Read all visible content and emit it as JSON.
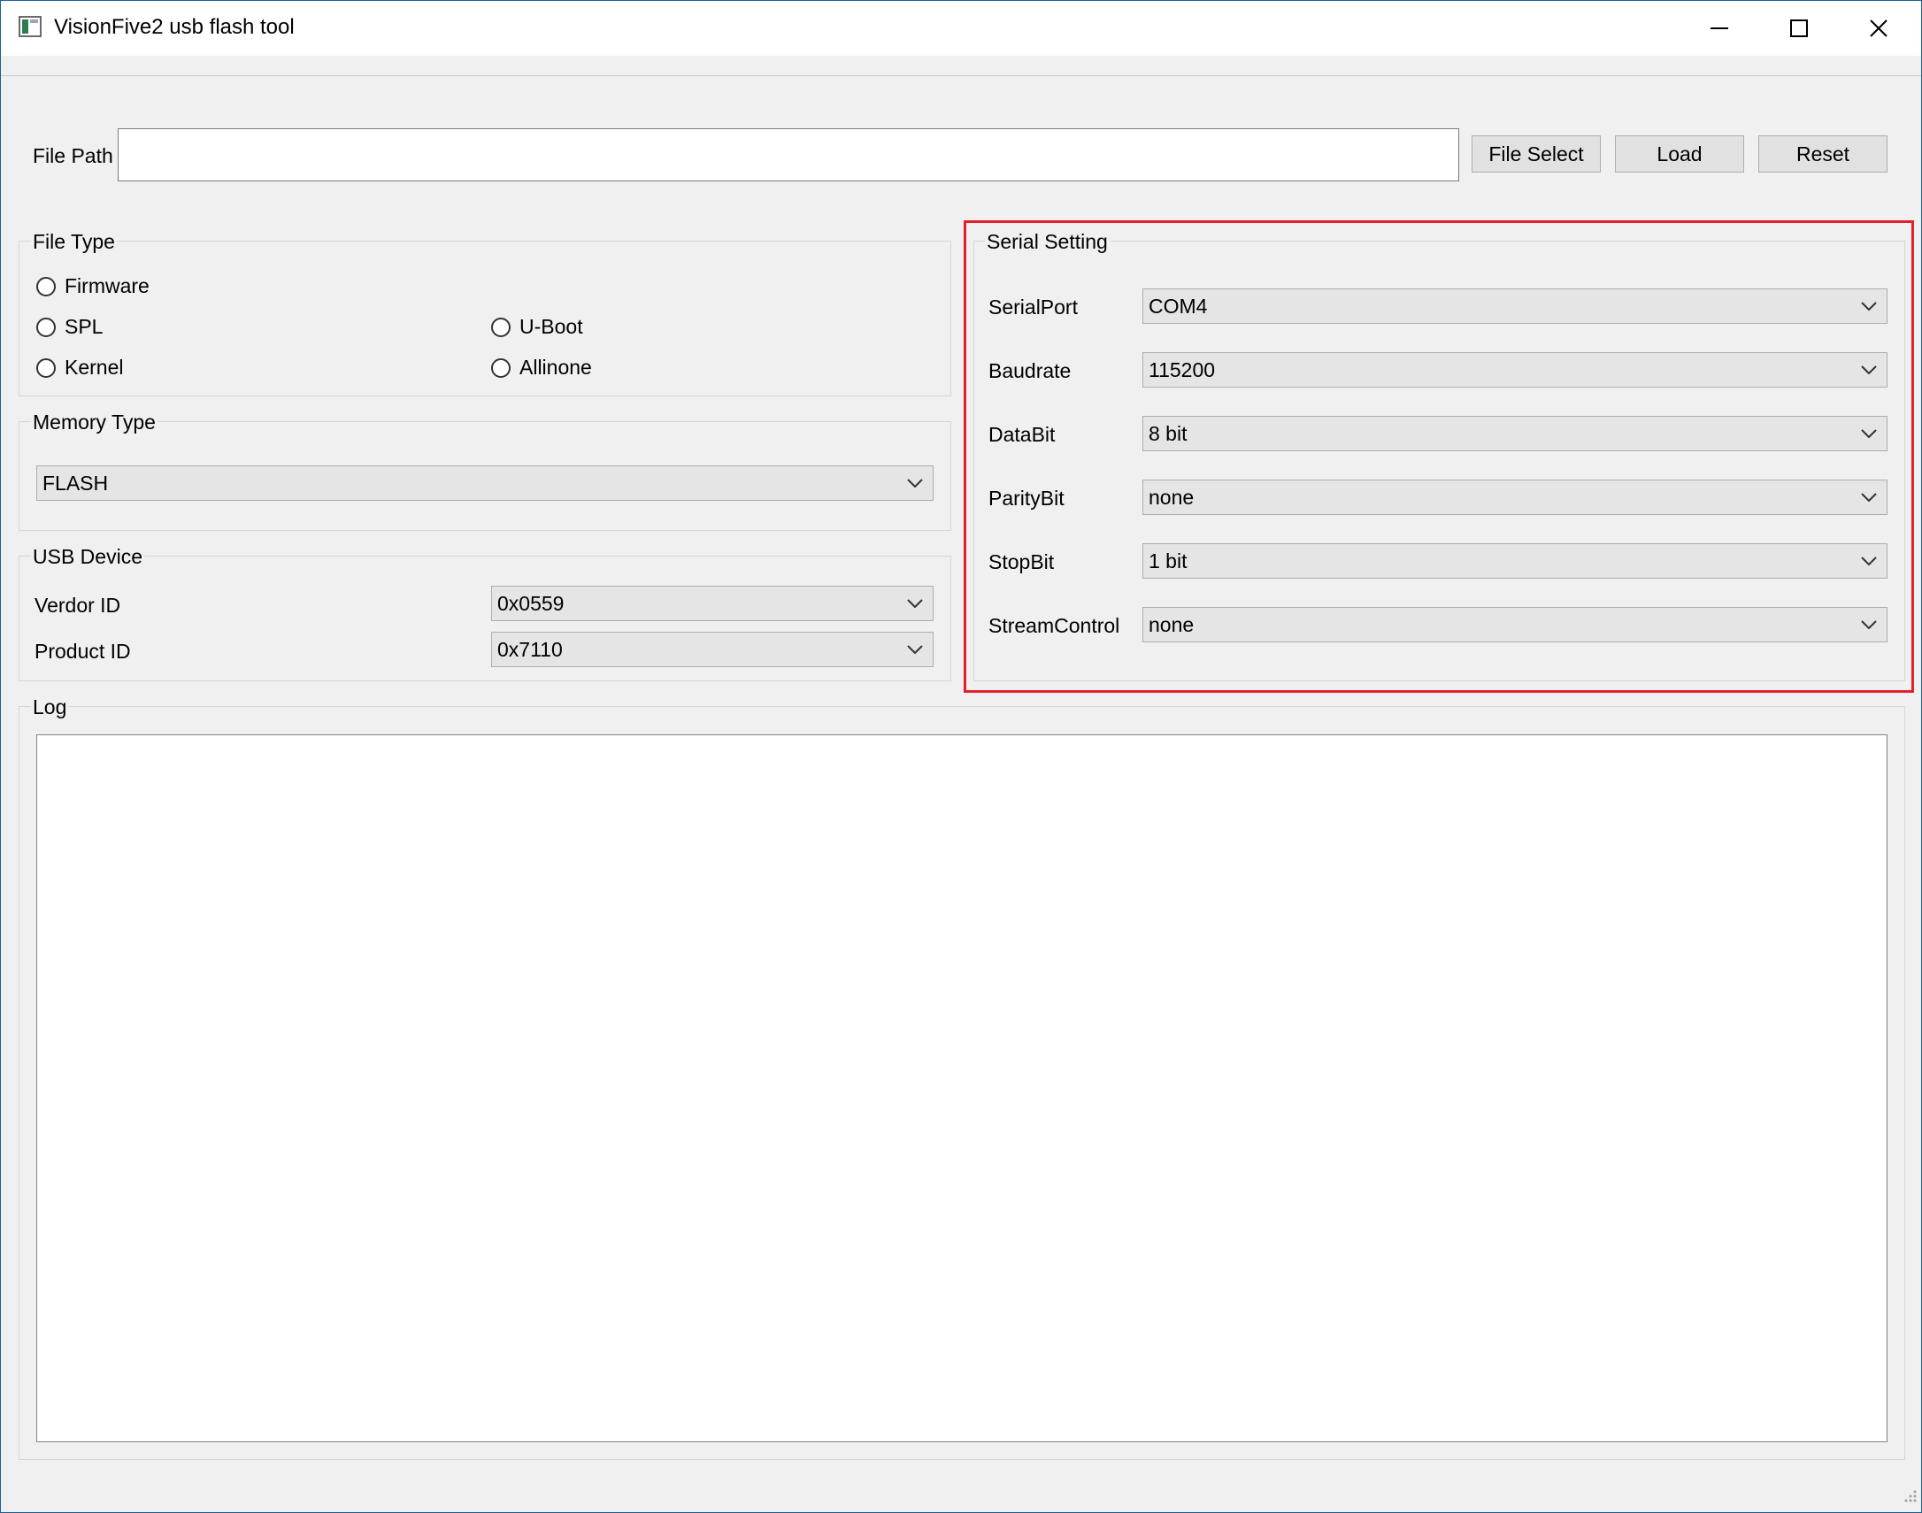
{
  "window": {
    "title": "VisionFive2 usb flash tool",
    "controls": {
      "minimize": "minimize-icon",
      "maximize": "maximize-icon",
      "close": "close-icon"
    }
  },
  "file_path": {
    "label": "File Path",
    "value": "",
    "buttons": {
      "file_select": "File Select",
      "load": "Load",
      "reset": "Reset"
    }
  },
  "file_type": {
    "title": "File Type",
    "options": [
      "Firmware",
      "SPL",
      "U-Boot",
      "Kernel",
      "Allinone"
    ],
    "selected": ""
  },
  "memory_type": {
    "title": "Memory Type",
    "value": "FLASH"
  },
  "usb_device": {
    "title": "USB Device",
    "vendor_label": "Verdor ID",
    "vendor_value": "0x0559",
    "product_label": "Product ID",
    "product_value": "0x7110"
  },
  "serial_setting": {
    "title": "Serial Setting",
    "highlight_color": "#e0202a",
    "fields": [
      {
        "label": "SerialPort",
        "value": "COM4"
      },
      {
        "label": "Baudrate",
        "value": "115200"
      },
      {
        "label": "DataBit",
        "value": "8 bit"
      },
      {
        "label": "ParityBit",
        "value": "none"
      },
      {
        "label": "StopBit",
        "value": "1 bit"
      },
      {
        "label": "StreamControl",
        "value": "none"
      }
    ]
  },
  "log": {
    "title": "Log",
    "content": ""
  }
}
